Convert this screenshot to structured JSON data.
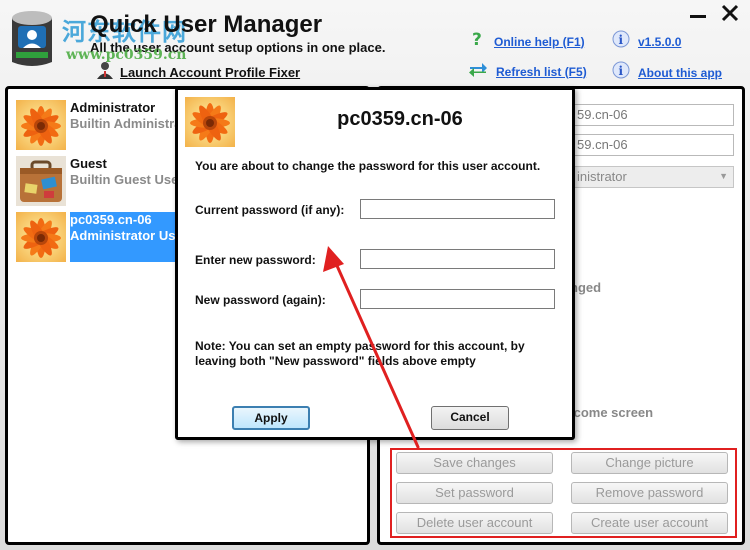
{
  "header": {
    "title": "Quick User Manager",
    "subtitle": "All the user account setup options in one place.",
    "launch_fixer_label": "Launch Account Profile Fixer",
    "links": {
      "help": "Online help (F1)",
      "version": "v1.5.0.0",
      "refresh": "Refresh list (F5)",
      "about": "About this app"
    },
    "close_glyph": "✕"
  },
  "watermark": {
    "cn_text": "河东软件网",
    "url": "www.pc0359.cn"
  },
  "users": [
    {
      "name": "Administrator",
      "description": "Builtin Administra",
      "avatar": "flower-avatar",
      "selected": false
    },
    {
      "name": "Guest",
      "description": "Builtin Guest Use",
      "avatar": "suitcase-avatar",
      "selected": false
    },
    {
      "name": "pc0359.cn-06",
      "description": "Administrator Use",
      "avatar": "flower-avatar",
      "selected": true
    }
  ],
  "details": {
    "field1_value": "59.cn-06",
    "field2_value": "59.cn-06",
    "account_type_value": "inistrator",
    "password_changed_fragment": "nged",
    "welcome_screen_fragment": "lcome screen"
  },
  "buttons": {
    "save_changes": "Save changes",
    "change_picture": "Change picture",
    "set_password": "Set password",
    "remove_password": "Remove password",
    "delete_user": "Delete user account",
    "create_user": "Create user account"
  },
  "dialog": {
    "title": "pc0359.cn-06",
    "intro": "You are about to change the password for this user account.",
    "current_label": "Current password (if any):",
    "new_label": "Enter new password:",
    "again_label": "New password (again):",
    "current_value": "",
    "new_value": "",
    "again_value": "",
    "note": "Note: You can set an empty password for this account, by leaving both \"New password\" fields above empty",
    "apply_label": "Apply",
    "cancel_label": "Cancel"
  },
  "annotation": {
    "arrow_color": "#e02020",
    "box_color": "#e02020"
  },
  "colors": {
    "link_blue": "#1e5bd3",
    "selection_blue": "#3399ff",
    "help_green": "#3aa84a"
  }
}
